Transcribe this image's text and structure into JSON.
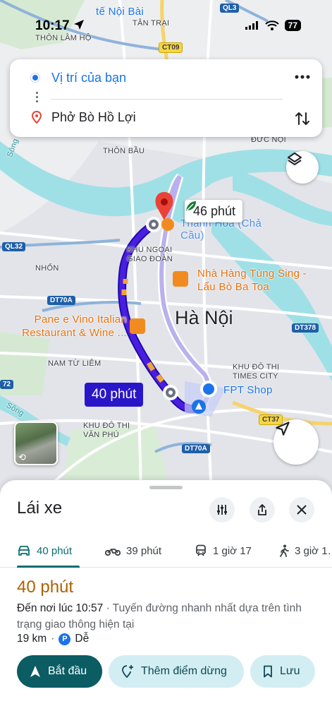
{
  "status_bar": {
    "time": "10:17",
    "battery": "77"
  },
  "search": {
    "origin": "Vị trí của bạn",
    "destination": "Phở Bò Hồ Lợi"
  },
  "map": {
    "labels": {
      "noi_bai": "tế Nội Bài",
      "thon_lam_ho": "THÔN LÂM HỘ",
      "tan_trai": "TÂN TRẠI",
      "thon_bau": "THÔN BẦU",
      "duc_noi": "ĐỨC NỘI",
      "song_hong": "Sông Hồng",
      "khu_ngoai_giao_doan": "KHU NGOẠI GIAO ĐOÀN",
      "nhon": "NHỔN",
      "nam_tu_liem": "NAM TỪ LIÊM",
      "ha_noi": "Hà Nội",
      "khu_do_thi_times_city": "KHU ĐÔ THỊ TIMES CITY",
      "khu_do_thi_van_phu": "KHU ĐÔ THỊ VĂN PHÚ",
      "thanh_hoa": "Thanh Hóa (Chả Cầu)",
      "song": "Sông"
    },
    "shields": {
      "ql3": "QL3",
      "ct09": "CT09",
      "ql32": "QL32",
      "dt70a_1": "DT70A",
      "dt70a_2": "DT70A",
      "dt378": "DT378",
      "ct37": "CT37",
      "n72": "72"
    },
    "pois": {
      "tung_sing": "Nhà Hàng Tùng Sing - Lẩu Bò Ba Toa",
      "pane_vino": "Pane e Vino Italian Restaurant & Wine ...",
      "fpt_shop": "FPT Shop"
    },
    "route_alt_time": "46 phút",
    "route_main_time": "40 phút",
    "colors": {
      "route_main": "#4a1ee0",
      "route_alt": "#b9b0ec",
      "water": "#9fe0e6",
      "park": "#c9e7c8"
    }
  },
  "sheet": {
    "title": "Lái xe",
    "modes": [
      {
        "icon": "car-icon",
        "label": "40 phút"
      },
      {
        "icon": "motorbike-icon",
        "label": "39 phút"
      },
      {
        "icon": "transit-icon",
        "label": "1 giờ 17"
      },
      {
        "icon": "walk-icon",
        "label": "3 giờ 1…"
      }
    ],
    "eta": "40 phút",
    "arrival_prefix": "Đến nơi lúc 10:57",
    "arrival_note": " · Tuyến đường nhanh nhất dựa trên tình trạng giao thông hiện tại",
    "distance": "19 km",
    "parking": "Dễ",
    "parking_icon": "P",
    "buttons": {
      "start": "Bắt đầu",
      "add_stop": "Thêm điểm dừng",
      "save": "Lưu"
    }
  }
}
